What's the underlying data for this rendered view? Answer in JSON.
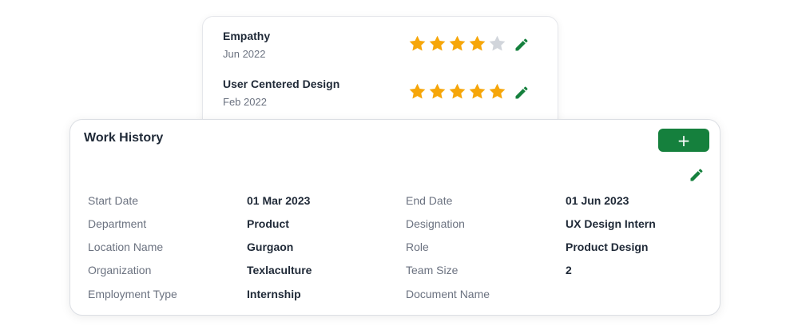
{
  "skills": [
    {
      "name": "Empathy",
      "date": "Jun 2022",
      "rating": 4,
      "max_rating": 5
    },
    {
      "name": "User Centered Design",
      "date": "Feb 2022",
      "rating": 5,
      "max_rating": 5
    }
  ],
  "work_history": {
    "title": "Work History",
    "add_label": "+",
    "fields": [
      {
        "label": "Start Date",
        "value": "01 Mar 2023"
      },
      {
        "label": "End Date",
        "value": "01 Jun 2023"
      },
      {
        "label": "Department",
        "value": "Product"
      },
      {
        "label": "Designation",
        "value": "UX Design Intern"
      },
      {
        "label": "Location Name",
        "value": "Gurgaon"
      },
      {
        "label": "Role",
        "value": "Product Design"
      },
      {
        "label": "Organization",
        "value": "Texlaculture"
      },
      {
        "label": "Team Size",
        "value": "2"
      },
      {
        "label": "Employment Type",
        "value": "Internship"
      },
      {
        "label": "Document Name",
        "value": ""
      }
    ]
  },
  "icons": {
    "star": "star-icon",
    "edit": "pencil-icon",
    "add": "plus-icon"
  },
  "colors": {
    "accent": "#15803d",
    "star_filled": "#f6a609",
    "star_empty": "#d1d5db"
  }
}
